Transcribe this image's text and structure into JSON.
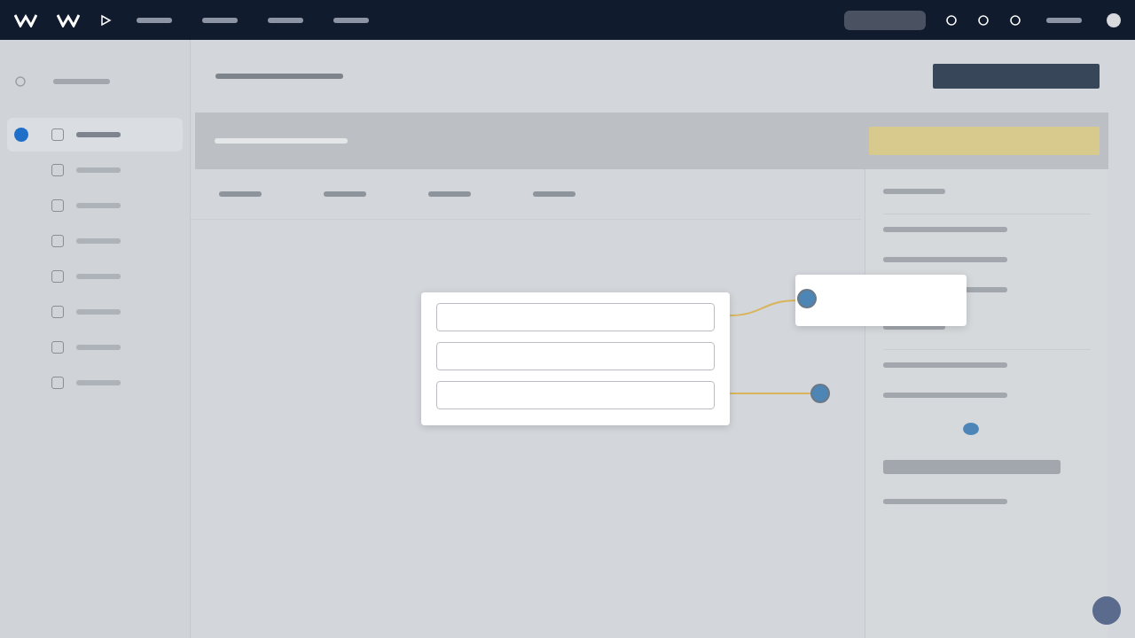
{
  "top_bar": {
    "items": [
      {
        "kind": "logo"
      },
      {
        "kind": "logo"
      },
      {
        "kind": "play"
      },
      {
        "kind": "link"
      },
      {
        "kind": "link"
      },
      {
        "kind": "link"
      },
      {
        "kind": "link"
      }
    ],
    "actions": [
      {
        "kind": "search"
      },
      {
        "kind": "icon"
      },
      {
        "kind": "icon"
      },
      {
        "kind": "icon"
      },
      {
        "kind": "link"
      },
      {
        "kind": "avatar"
      }
    ]
  },
  "sidebar": {
    "items": [
      {
        "kind": "header"
      },
      {
        "kind": "item",
        "selected": true
      },
      {
        "kind": "item",
        "selected": false
      },
      {
        "kind": "item",
        "selected": false
      },
      {
        "kind": "item",
        "selected": false
      },
      {
        "kind": "item",
        "selected": false
      },
      {
        "kind": "item",
        "selected": false
      },
      {
        "kind": "item",
        "selected": false
      },
      {
        "kind": "item",
        "selected": false
      }
    ]
  },
  "table": {
    "columns": [
      {
        "kind": "column"
      },
      {
        "kind": "column"
      },
      {
        "kind": "column"
      },
      {
        "kind": "column"
      }
    ]
  },
  "form": {
    "fields": [
      {
        "kind": "to_popover"
      },
      {
        "kind": "plain"
      },
      {
        "kind": "to_dot"
      }
    ]
  },
  "details": {
    "sections": [
      {
        "kind": "heading"
      },
      {
        "kind": "text"
      },
      {
        "kind": "text"
      },
      {
        "kind": "text"
      },
      {
        "kind": "heading"
      },
      {
        "kind": "text"
      },
      {
        "kind": "text"
      },
      {
        "kind": "image"
      },
      {
        "kind": "paragraph"
      },
      {
        "kind": "text"
      }
    ]
  }
}
